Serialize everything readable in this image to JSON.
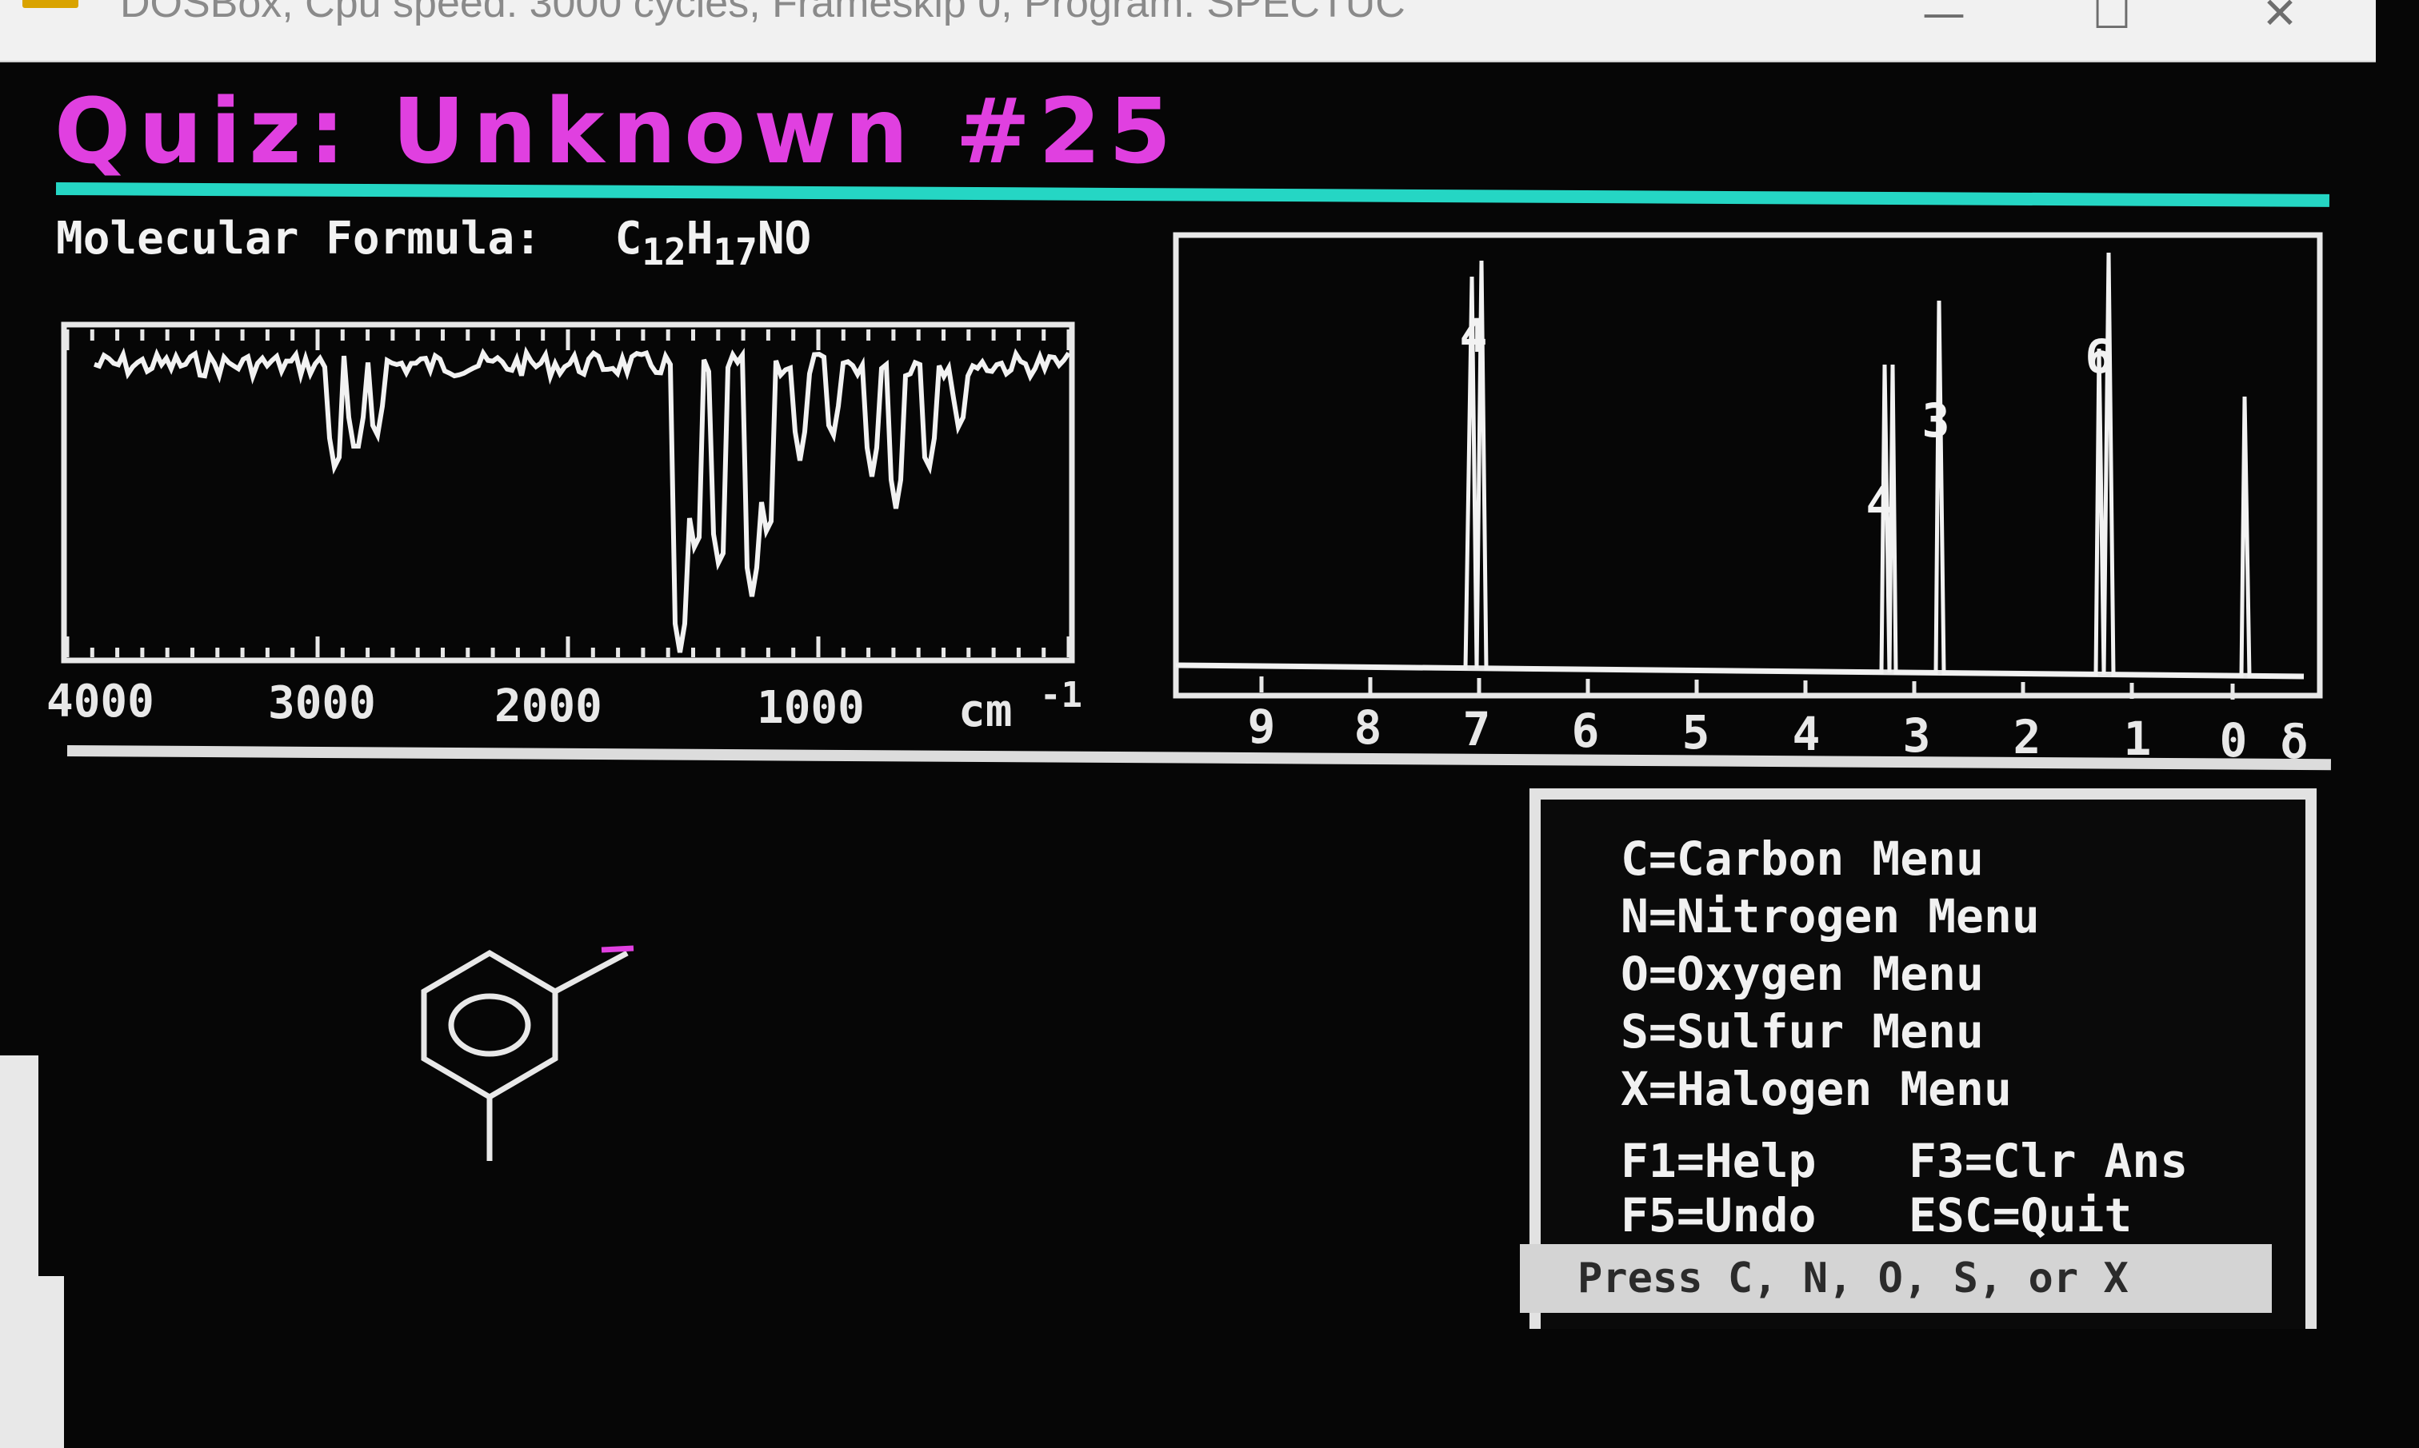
{
  "window": {
    "title": "DOSBox, Cpu speed:     3000 cycles, Frameskip  0, Program:  SPECTUC",
    "minimize_glyph": "—",
    "maximize_glyph": "☐",
    "close_glyph": "✕"
  },
  "quiz": {
    "title": "Quiz:  Unknown  #25",
    "formula_label": "Molecular Formula:",
    "formula_parts": [
      "C",
      "12",
      "H",
      "17",
      "NO"
    ]
  },
  "ir_spectrum": {
    "tick_labels": [
      "4000",
      "3000",
      "2000",
      "1000"
    ],
    "unit_label": "cm",
    "unit_exponent": "-1"
  },
  "nmr_spectrum": {
    "tick_labels": [
      "9",
      "8",
      "7",
      "6",
      "5",
      "4",
      "3",
      "2",
      "1",
      "0"
    ],
    "delta_symbol": "δ",
    "peak_labels": [
      "4",
      "4",
      "3",
      "6"
    ]
  },
  "structure": {
    "description_icon": "benzene-ring-icon"
  },
  "menu": {
    "items": [
      "C=Carbon Menu",
      "N=Nitrogen Menu",
      "O=Oxygen Menu",
      "S=Sulfur Menu",
      "X=Halogen Menu"
    ],
    "help": "F1=Help",
    "clear": "F3=Clr Ans",
    "undo": "F5=Undo",
    "quit": "ESC=Quit",
    "prompt": "Press C, N, O, S, or X"
  },
  "colors": {
    "title": "#e040e0",
    "rule": "#25d6c4",
    "text": "#f2f2f2",
    "cursor": "#e040e0"
  }
}
